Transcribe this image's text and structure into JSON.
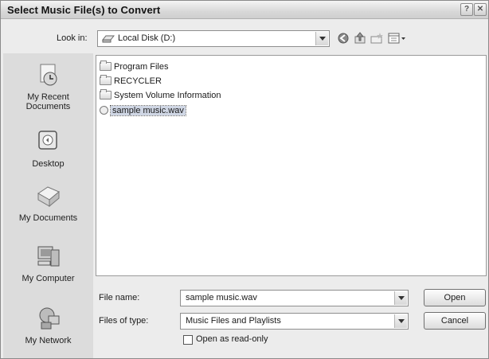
{
  "window": {
    "title": "Select Music File(s) to Convert",
    "help_glyph": "?",
    "close_glyph": "✕"
  },
  "look_in": {
    "label": "Look in:",
    "value": "Local Disk (D:)"
  },
  "places": [
    {
      "label_line1": "My Recent",
      "label_line2": "Documents"
    },
    {
      "label_line1": "Desktop",
      "label_line2": ""
    },
    {
      "label_line1": "My Documents",
      "label_line2": ""
    },
    {
      "label_line1": "My Computer",
      "label_line2": ""
    },
    {
      "label_line1": "My Network",
      "label_line2": ""
    }
  ],
  "files": [
    {
      "name": "Program Files",
      "type": "folder"
    },
    {
      "name": "RECYCLER",
      "type": "folder"
    },
    {
      "name": "System Volume Information",
      "type": "folder"
    },
    {
      "name": "sample music.wav",
      "type": "wav",
      "selected": true
    }
  ],
  "file_name": {
    "label": "File name:",
    "value": "sample music.wav"
  },
  "file_type": {
    "label": "Files of type:",
    "value": "Music Files and Playlists"
  },
  "read_only": {
    "label": "Open as read-only",
    "checked": false
  },
  "buttons": {
    "open": "Open",
    "cancel": "Cancel"
  }
}
